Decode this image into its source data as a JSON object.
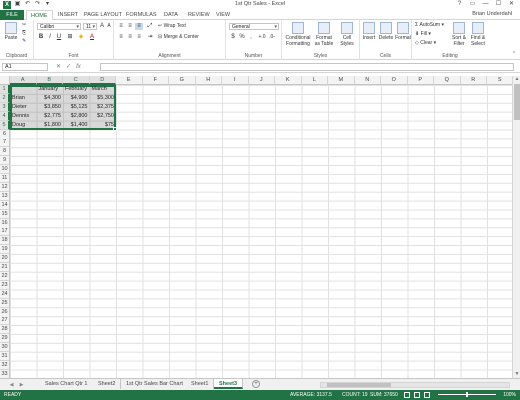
{
  "window": {
    "title": "1st Qtr Sales - Excel",
    "logo": "X",
    "qat_icons": [
      "save-icon",
      "undo-icon",
      "redo-icon",
      "touch-mode-icon"
    ],
    "controls": [
      "?",
      "▭",
      "—",
      "☐",
      "✕"
    ]
  },
  "ribbon_tabs": [
    "FILE",
    "HOME",
    "INSERT",
    "PAGE LAYOUT",
    "FORMULAS",
    "DATA",
    "REVIEW",
    "VIEW"
  ],
  "active_tab": "HOME",
  "user": "Brian Underdahl",
  "ribbon": {
    "clipboard": {
      "label": "Clipboard",
      "paste": "Paste"
    },
    "font": {
      "label": "Font",
      "font_name": "Calibri",
      "font_size": "11",
      "bold": "B",
      "italic": "I",
      "underline": "U",
      "grow": "A",
      "shrink": "A",
      "fill": "◈",
      "font_color": "A"
    },
    "alignment": {
      "label": "Alignment",
      "wrap": "Wrap Text",
      "merge": "Merge & Center"
    },
    "number": {
      "label": "Number",
      "format": "General",
      "currency": "$",
      "percent": "%",
      "comma": ","
    },
    "styles": {
      "label": "Styles",
      "conditional": "Conditional Formatting",
      "format_table": "Format as Table",
      "cell_styles": "Cell Styles"
    },
    "cells": {
      "label": "Cells",
      "insert": "Insert",
      "delete": "Delete",
      "format": "Format"
    },
    "editing": {
      "label": "Editing",
      "autosum": "AutoSum",
      "fill": "Fill",
      "clear": "Clear",
      "sort": "Sort & Filter",
      "find": "Find & Select"
    }
  },
  "formula_bar": {
    "name_box": "A1",
    "cancel": "✕",
    "enter": "✓",
    "fx": "fx",
    "content": ""
  },
  "columns": [
    "A",
    "B",
    "C",
    "D",
    "E",
    "F",
    "G",
    "H",
    "I",
    "J",
    "K",
    "L",
    "M",
    "N",
    "O",
    "P",
    "Q",
    "R",
    "S"
  ],
  "row_count": 33,
  "sheet": {
    "header": [
      "",
      "January",
      "February",
      "March"
    ],
    "rows": [
      [
        "Brian",
        "$4,300",
        "$4,900",
        "$5,300"
      ],
      [
        "Dieter",
        "$3,850",
        "$5,125",
        "$2,375"
      ],
      [
        "Dennis",
        "$2,775",
        "$2,800",
        "$2,750"
      ],
      [
        "Doug",
        "$1,800",
        "$1,400",
        "$75"
      ]
    ]
  },
  "sheet_tabs": [
    "Sales Chart Qtr 1",
    "Sheet2",
    "1st Qtr Sales Bar Chart",
    "Sheet1",
    "Sheet3"
  ],
  "active_sheet": "Sheet3",
  "status": {
    "ready": "READY",
    "average": "AVERAGE: 3137.5",
    "count": "COUNT: 19",
    "sum": "SUM: 37650",
    "zoom": "100%"
  }
}
